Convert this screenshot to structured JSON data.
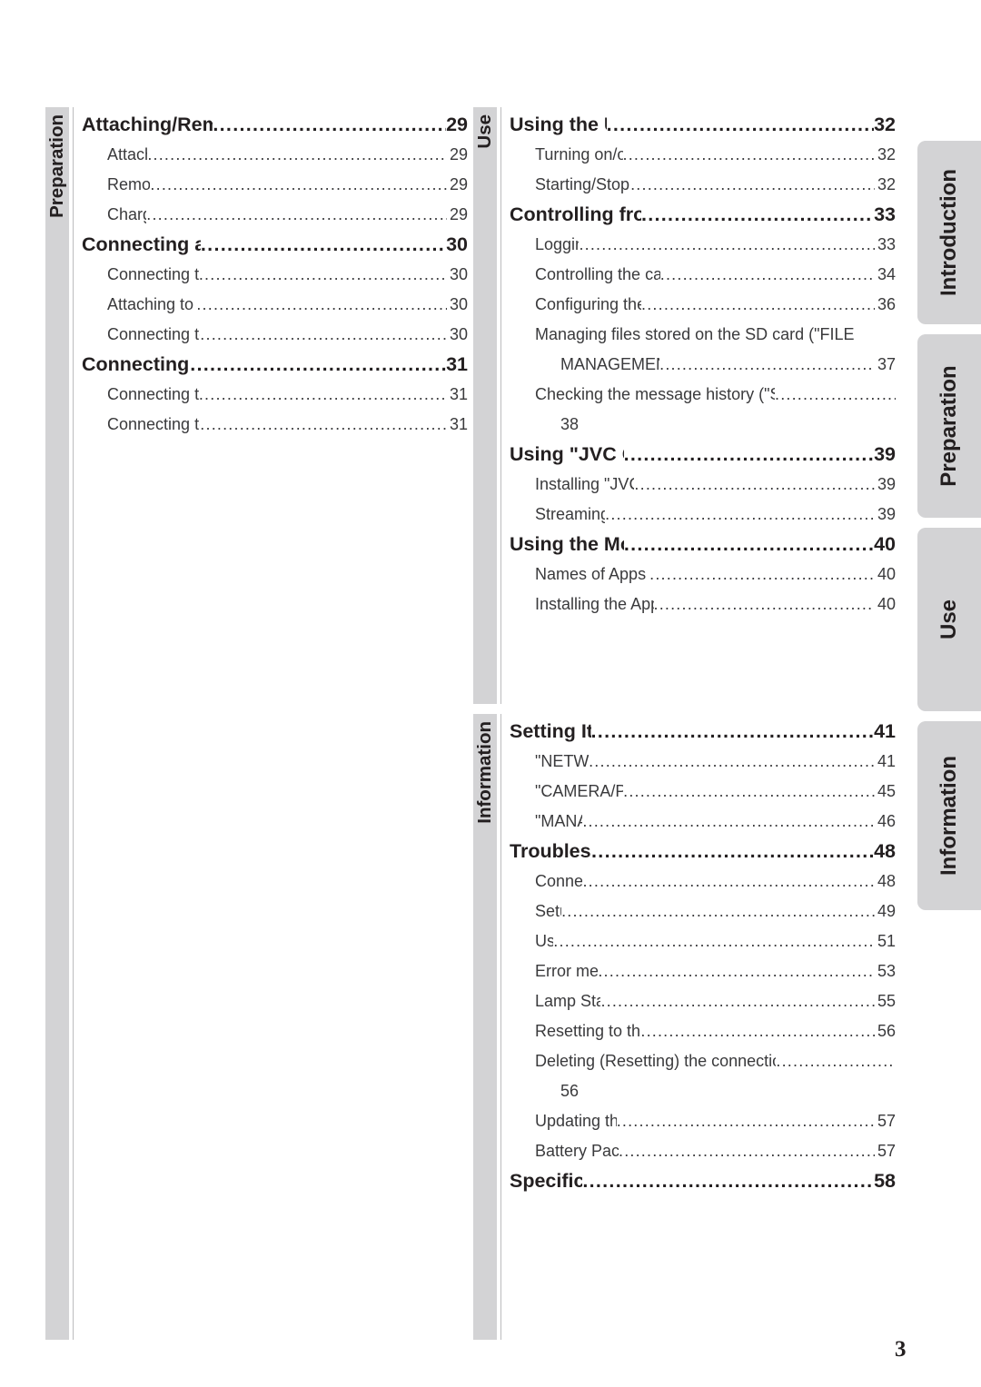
{
  "page": {
    "folio": "3",
    "accent_gray": "#d3d3d5",
    "text_color": "#231f20"
  },
  "left_column": {
    "band_label": "Preparation",
    "entries": [
      {
        "kind": "heading",
        "title": "Attaching/Removing the Battery",
        "page": "29"
      },
      {
        "kind": "sub",
        "title": "Attaching",
        "page": "29"
      },
      {
        "kind": "sub",
        "title": "Removing",
        "page": "29"
      },
      {
        "kind": "sub",
        "title": "Charging",
        "page": "29"
      },
      {
        "kind": "heading",
        "title": "Connecting an External Mic",
        "page": "30"
      },
      {
        "kind": "sub",
        "title": "Connecting to the camera",
        "page": "30"
      },
      {
        "kind": "sub",
        "title": "Attaching to the hot shoe",
        "page": "30"
      },
      {
        "kind": "sub",
        "title": "Connecting to the pantilter",
        "page": "30"
      },
      {
        "kind": "heading",
        "title": "Connecting the AV Cord",
        "page": "31"
      },
      {
        "kind": "sub",
        "title": "Connecting to the camera",
        "page": "31"
      },
      {
        "kind": "sub",
        "title": "Connecting to the pantilter",
        "page": "31"
      }
    ]
  },
  "middle_column_use": {
    "band_label": "Use",
    "entries": [
      {
        "kind": "heading",
        "title": "Using the Unit Alone",
        "page": "32"
      },
      {
        "kind": "sub",
        "title": "Turning on/off the power",
        "page": "32"
      },
      {
        "kind": "sub",
        "title": "Starting/Stopping recording",
        "page": "32"
      },
      {
        "kind": "heading",
        "title": "Controlling from a Web Browser",
        "page": "33"
      },
      {
        "kind": "sub",
        "title": "Logging in",
        "page": "33"
      },
      {
        "kind": "sub",
        "title": "Controlling the camera (\"MONITOR\" tab)",
        "page": "34"
      },
      {
        "kind": "sub",
        "title": "Configuring the camera settings",
        "page": "36"
      },
      {
        "kind": "sub-wrap",
        "line1": "Managing files stored on the SD card (\"FILE",
        "line2": "MANAGEMENT\" tab)",
        "page": "37"
      },
      {
        "kind": "sub-wrap-pgonly",
        "line1": "Checking the message history (\"STATUS\" tab)",
        "page": "38"
      },
      {
        "kind": "heading",
        "title": "Using \"JVC CAM Control\"",
        "page": "39"
      },
      {
        "kind": "sub",
        "title": "Installing \"JVC CAM Control\"",
        "page": "39"
      },
      {
        "kind": "sub",
        "title": "Streaming images",
        "page": "39"
      },
      {
        "kind": "heading",
        "title": "Using the Mobile Terminal",
        "page": "40"
      },
      {
        "kind": "sub",
        "title": "Names of Apps for mobile terminals",
        "page": "40"
      },
      {
        "kind": "sub",
        "title": "Installing the App for mobile terminals",
        "page": "40"
      }
    ]
  },
  "middle_column_information": {
    "band_label": "Information",
    "entries": [
      {
        "kind": "heading",
        "title": "Setting Item List",
        "page": "41"
      },
      {
        "kind": "sub",
        "title": "\"NETWORK\"",
        "page": "41"
      },
      {
        "kind": "sub",
        "title": "\"CAMERA/PAN TILTER\"",
        "page": "45"
      },
      {
        "kind": "sub",
        "title": "\"MANAGE\"",
        "page": "46"
      },
      {
        "kind": "heading",
        "title": "Troubleshooting",
        "page": "48"
      },
      {
        "kind": "sub",
        "title": "Connection",
        "page": "48"
      },
      {
        "kind": "sub",
        "title": "Setup",
        "page": "49"
      },
      {
        "kind": "sub",
        "title": "Use",
        "page": "51"
      },
      {
        "kind": "sub",
        "title": "Error messages",
        "page": "53"
      },
      {
        "kind": "sub",
        "title": "Lamp Status List",
        "page": "55"
      },
      {
        "kind": "sub",
        "title": "Resetting to the factory settings",
        "page": "56"
      },
      {
        "kind": "sub-wrap-pgonly",
        "line1": "Deleting (Resetting) the connection information",
        "page": "56"
      },
      {
        "kind": "sub",
        "title": "Updating the firmware",
        "page": "57"
      },
      {
        "kind": "sub",
        "title": "Battery Pack (optional)",
        "page": "57"
      },
      {
        "kind": "heading",
        "title": "Specifications",
        "page": "58"
      }
    ]
  },
  "thumb_tabs": [
    {
      "label": "Introduction"
    },
    {
      "label": "Preparation"
    },
    {
      "label": "Use"
    },
    {
      "label": "Information"
    }
  ]
}
